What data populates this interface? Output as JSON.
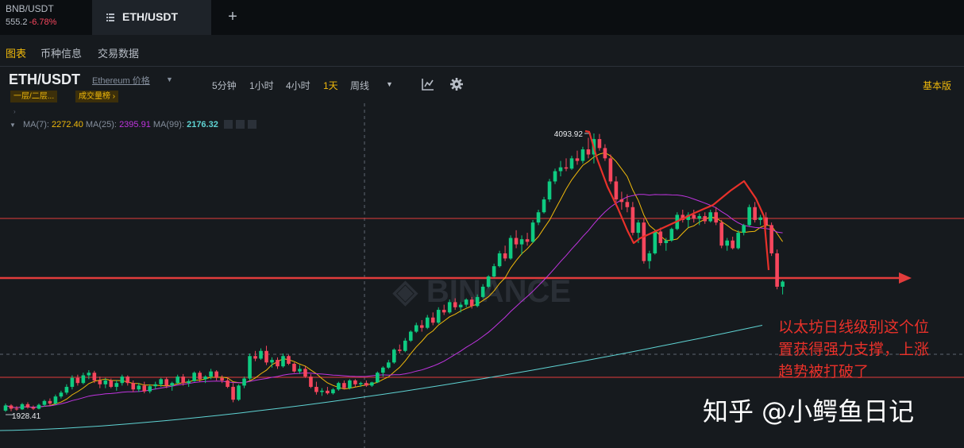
{
  "tabs": {
    "bnb": {
      "symbol": "BNB/USDT",
      "price": "555.2",
      "change": "-6.78%"
    },
    "eth": {
      "symbol": "ETH/USDT"
    }
  },
  "subnav": {
    "items": [
      "图表",
      "币种信息",
      "交易数据"
    ]
  },
  "header": {
    "pair": "ETH/USDT",
    "subtitle": "Ethereum 价格",
    "tag1": "一层/二层...",
    "tag2": "成交量榜 ›",
    "intervals": [
      "5分钟",
      "1小时",
      "4小时",
      "1天",
      "周线"
    ],
    "basic": "基本版"
  },
  "ma": {
    "ma7_label": "MA(7):",
    "ma7": "2272.40",
    "ma25_label": "MA(25):",
    "ma25": "2395.91",
    "ma99_label": "MA(99):",
    "ma99": "2176.32"
  },
  "chart_data": {
    "type": "candlestick",
    "high_label": "4093.92",
    "low_label": "1928.41",
    "up_color": "#0ecb81",
    "down_color": "#f6465d",
    "ohlc": [
      [
        1935,
        1990,
        1925,
        1975
      ],
      [
        1975,
        1985,
        1930,
        1950
      ],
      [
        1950,
        1970,
        1935,
        1945
      ],
      [
        1945,
        1995,
        1940,
        1985
      ],
      [
        1985,
        2000,
        1950,
        1960
      ],
      [
        1960,
        1975,
        1940,
        1950
      ],
      [
        1950,
        1990,
        1945,
        1980
      ],
      [
        1980,
        2020,
        1965,
        2010
      ],
      [
        2010,
        2030,
        1975,
        1990
      ],
      [
        1990,
        2060,
        1980,
        2045
      ],
      [
        2045,
        2090,
        2030,
        2075
      ],
      [
        2075,
        2140,
        2060,
        2120
      ],
      [
        2120,
        2210,
        2100,
        2190
      ],
      [
        2190,
        2215,
        2130,
        2150
      ],
      [
        2150,
        2230,
        2140,
        2210
      ],
      [
        2210,
        2250,
        2180,
        2230
      ],
      [
        2230,
        2245,
        2150,
        2170
      ],
      [
        2170,
        2200,
        2110,
        2140
      ],
      [
        2140,
        2190,
        2110,
        2170
      ],
      [
        2170,
        2185,
        2110,
        2120
      ],
      [
        2120,
        2170,
        2090,
        2150
      ],
      [
        2150,
        2215,
        2130,
        2200
      ],
      [
        2200,
        2210,
        2130,
        2150
      ],
      [
        2150,
        2170,
        2080,
        2100
      ],
      [
        2100,
        2150,
        2080,
        2130
      ],
      [
        2130,
        2160,
        2070,
        2085
      ],
      [
        2085,
        2140,
        2070,
        2125
      ],
      [
        2125,
        2160,
        2100,
        2140
      ],
      [
        2140,
        2190,
        2120,
        2180
      ],
      [
        2180,
        2195,
        2110,
        2130
      ],
      [
        2130,
        2160,
        2090,
        2150
      ],
      [
        2150,
        2215,
        2140,
        2200
      ],
      [
        2200,
        2220,
        2130,
        2150
      ],
      [
        2150,
        2180,
        2120,
        2165
      ],
      [
        2165,
        2240,
        2160,
        2230
      ],
      [
        2230,
        2245,
        2160,
        2180
      ],
      [
        2180,
        2210,
        2150,
        2200
      ],
      [
        2200,
        2260,
        2180,
        2240
      ],
      [
        2240,
        2250,
        2170,
        2190
      ],
      [
        2190,
        2210,
        2150,
        2170
      ],
      [
        2170,
        2190,
        2110,
        2120
      ],
      [
        2120,
        2150,
        2000,
        2020
      ],
      [
        2020,
        2140,
        2010,
        2130
      ],
      [
        2130,
        2200,
        2110,
        2185
      ],
      [
        2185,
        2380,
        2170,
        2360
      ],
      [
        2360,
        2400,
        2320,
        2340
      ],
      [
        2340,
        2420,
        2330,
        2400
      ],
      [
        2400,
        2440,
        2290,
        2310
      ],
      [
        2310,
        2350,
        2270,
        2330
      ],
      [
        2330,
        2350,
        2260,
        2280
      ],
      [
        2280,
        2380,
        2270,
        2360
      ],
      [
        2360,
        2370,
        2290,
        2300
      ],
      [
        2300,
        2310,
        2230,
        2240
      ],
      [
        2240,
        2290,
        2220,
        2260
      ],
      [
        2260,
        2280,
        2190,
        2200
      ],
      [
        2200,
        2220,
        2110,
        2120
      ],
      [
        2120,
        2160,
        2060,
        2080
      ],
      [
        2080,
        2110,
        2050,
        2090
      ],
      [
        2090,
        2120,
        2060,
        2070
      ],
      [
        2070,
        2110,
        2060,
        2100
      ],
      [
        2100,
        2160,
        2090,
        2150
      ],
      [
        2150,
        2170,
        2100,
        2110
      ],
      [
        2110,
        2180,
        2100,
        2170
      ],
      [
        2170,
        2180,
        2120,
        2140
      ],
      [
        2140,
        2160,
        2120,
        2150
      ],
      [
        2150,
        2170,
        2120,
        2130
      ],
      [
        2130,
        2160,
        2120,
        2155
      ],
      [
        2155,
        2240,
        2150,
        2230
      ],
      [
        2230,
        2280,
        2200,
        2270
      ],
      [
        2270,
        2330,
        2260,
        2310
      ],
      [
        2310,
        2420,
        2300,
        2410
      ],
      [
        2410,
        2450,
        2380,
        2400
      ],
      [
        2400,
        2500,
        2390,
        2480
      ],
      [
        2480,
        2560,
        2470,
        2550
      ],
      [
        2550,
        2620,
        2540,
        2600
      ],
      [
        2600,
        2640,
        2550,
        2580
      ],
      [
        2580,
        2680,
        2570,
        2660
      ],
      [
        2660,
        2700,
        2600,
        2620
      ],
      [
        2620,
        2740,
        2610,
        2720
      ],
      [
        2720,
        2760,
        2680,
        2700
      ],
      [
        2700,
        2800,
        2690,
        2780
      ],
      [
        2780,
        2810,
        2720,
        2740
      ],
      [
        2740,
        2780,
        2700,
        2760
      ],
      [
        2760,
        2810,
        2740,
        2800
      ],
      [
        2800,
        2820,
        2730,
        2750
      ],
      [
        2750,
        2840,
        2740,
        2820
      ],
      [
        2820,
        2920,
        2810,
        2900
      ],
      [
        2900,
        2990,
        2890,
        2980
      ],
      [
        2980,
        3080,
        2970,
        3060
      ],
      [
        3060,
        3180,
        3050,
        3160
      ],
      [
        3160,
        3220,
        3100,
        3120
      ],
      [
        3120,
        3300,
        3110,
        3280
      ],
      [
        3280,
        3340,
        3200,
        3230
      ],
      [
        3230,
        3300,
        3150,
        3270
      ],
      [
        3270,
        3320,
        3220,
        3250
      ],
      [
        3250,
        3420,
        3240,
        3400
      ],
      [
        3400,
        3500,
        3380,
        3480
      ],
      [
        3480,
        3600,
        3470,
        3580
      ],
      [
        3580,
        3740,
        3560,
        3720
      ],
      [
        3720,
        3820,
        3700,
        3800
      ],
      [
        3800,
        3880,
        3760,
        3830
      ],
      [
        3830,
        3900,
        3800,
        3820
      ],
      [
        3820,
        3920,
        3810,
        3900
      ],
      [
        3900,
        3960,
        3850,
        3880
      ],
      [
        3880,
        3990,
        3860,
        3970
      ],
      [
        3970,
        4060,
        3900,
        3930
      ],
      [
        3930,
        4093.92,
        3860,
        4050
      ],
      [
        4050,
        4090,
        3960,
        3980
      ],
      [
        3980,
        4010,
        3880,
        3900
      ],
      [
        3900,
        3930,
        3700,
        3720
      ],
      [
        3720,
        3760,
        3560,
        3580
      ],
      [
        3580,
        3640,
        3500,
        3560
      ],
      [
        3560,
        3620,
        3480,
        3520
      ],
      [
        3520,
        3560,
        3300,
        3320
      ],
      [
        3320,
        3420,
        3240,
        3400
      ],
      [
        3400,
        3430,
        3080,
        3100
      ],
      [
        3100,
        3180,
        3040,
        3160
      ],
      [
        3160,
        3340,
        3150,
        3330
      ],
      [
        3330,
        3360,
        3220,
        3240
      ],
      [
        3240,
        3280,
        3180,
        3260
      ],
      [
        3260,
        3360,
        3250,
        3350
      ],
      [
        3350,
        3480,
        3340,
        3460
      ],
      [
        3460,
        3500,
        3400,
        3420
      ],
      [
        3420,
        3480,
        3360,
        3460
      ],
      [
        3460,
        3500,
        3400,
        3430
      ],
      [
        3430,
        3470,
        3380,
        3450
      ],
      [
        3450,
        3480,
        3390,
        3410
      ],
      [
        3410,
        3500,
        3400,
        3480
      ],
      [
        3480,
        3520,
        3380,
        3400
      ],
      [
        3400,
        3420,
        3200,
        3220
      ],
      [
        3220,
        3280,
        3180,
        3260
      ],
      [
        3260,
        3290,
        3190,
        3200
      ],
      [
        3200,
        3340,
        3190,
        3320
      ],
      [
        3320,
        3390,
        3300,
        3380
      ],
      [
        3380,
        3540,
        3370,
        3520
      ],
      [
        3520,
        3560,
        3400,
        3420
      ],
      [
        3420,
        3460,
        3380,
        3440
      ],
      [
        3440,
        3480,
        3360,
        3380
      ],
      [
        3380,
        3400,
        3140,
        3160
      ],
      [
        3160,
        3190,
        2880,
        2900
      ],
      [
        2900,
        2950,
        2840,
        2940
      ]
    ]
  },
  "annotation": {
    "lines": [
      "以太坊日线级别这个位",
      "置获得强力支撑，上涨",
      "趋势被打破了"
    ]
  },
  "watermark": "知乎 @小鳄鱼日记"
}
